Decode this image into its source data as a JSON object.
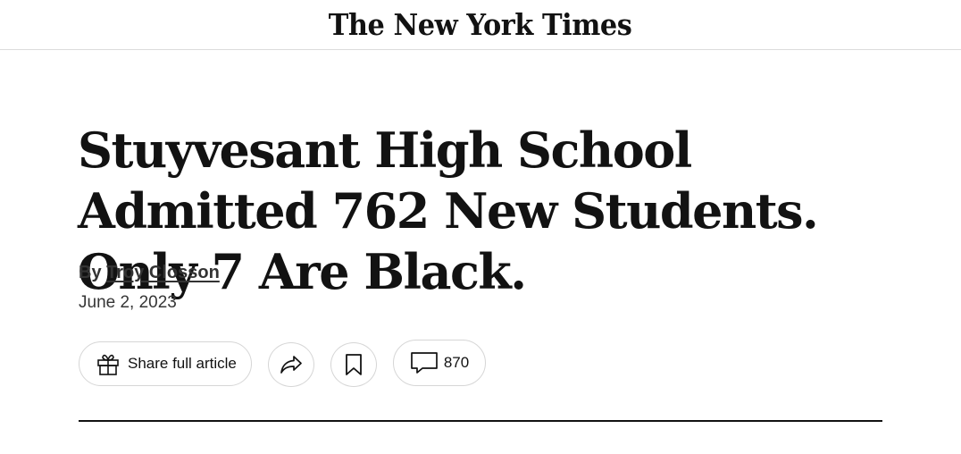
{
  "masthead": {
    "logo_text": "The New York Times"
  },
  "article": {
    "headline": "Stuyvesant High School Admitted 762 New Students. Only 7 Are Black.",
    "byline_prefix": "By ",
    "author": "Troy Closson",
    "date": "June 2, 2023"
  },
  "actions": {
    "share_full_label": "Share full article",
    "comment_count": "870",
    "icons": {
      "gift": "gift-icon",
      "share": "share-arrow-icon",
      "save": "bookmark-icon",
      "comment": "comment-bubble-icon"
    }
  },
  "colors": {
    "text": "#121212",
    "border": "#d6d6d6",
    "divider": "#dcdcdc"
  }
}
